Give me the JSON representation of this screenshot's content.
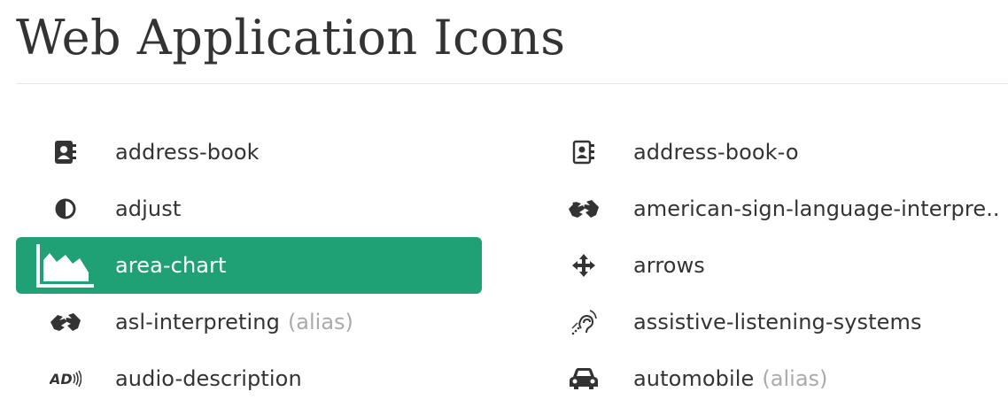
{
  "page": {
    "title": "Web Application Icons"
  },
  "colors": {
    "accent": "#1fa075",
    "text": "#333333",
    "alias": "#aaaaaa",
    "rule": "#e5e5e5"
  },
  "icons": [
    {
      "label": "address-book",
      "icon": "address-book-icon",
      "alias": "",
      "active": false
    },
    {
      "label": "address-book-o",
      "icon": "address-book-o-icon",
      "alias": "",
      "active": false
    },
    {
      "label": "adjust",
      "icon": "adjust-icon",
      "alias": "",
      "active": false
    },
    {
      "label": "american-sign-language-interpre..",
      "icon": "asl-interpreting-icon",
      "alias": "",
      "active": false
    },
    {
      "label": "area-chart",
      "icon": "area-chart-icon",
      "alias": "",
      "active": true
    },
    {
      "label": "arrows",
      "icon": "arrows-icon",
      "alias": "",
      "active": false
    },
    {
      "label": "asl-interpreting",
      "icon": "asl-interpreting-icon",
      "alias": "(alias)",
      "active": false
    },
    {
      "label": "assistive-listening-systems",
      "icon": "assistive-listening-icon",
      "alias": "",
      "active": false
    },
    {
      "label": "audio-description",
      "icon": "audio-description-icon",
      "alias": "",
      "active": false
    },
    {
      "label": "automobile",
      "icon": "car-icon",
      "alias": "(alias)",
      "active": false
    }
  ]
}
